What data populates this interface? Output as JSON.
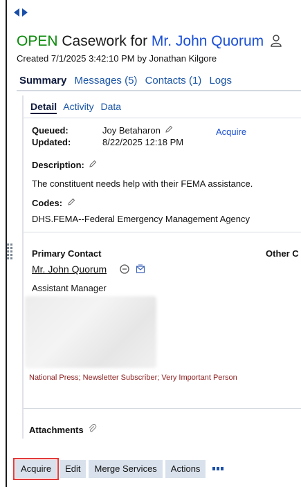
{
  "header": {
    "status": "OPEN",
    "casework_label": "Casework for",
    "person_name": "Mr. John Quorum",
    "created_line": "Created 7/1/2025 3:42:10 PM by Jonathan Kilgore"
  },
  "tabs": [
    {
      "label": "Summary",
      "active": true
    },
    {
      "label": "Messages (5)",
      "active": false
    },
    {
      "label": "Contacts (1)",
      "active": false
    },
    {
      "label": "Logs",
      "active": false
    }
  ],
  "subtabs": [
    {
      "label": "Detail",
      "active": true
    },
    {
      "label": "Activity",
      "active": false
    },
    {
      "label": "Data",
      "active": false
    }
  ],
  "detail": {
    "queued_label": "Queued:",
    "queued_value": "Joy Betaharon",
    "acquire_link": "Acquire",
    "updated_label": "Updated:",
    "updated_value": "8/22/2025 12:18 PM",
    "description_label": "Description:",
    "description_value": "The constituent needs help with their FEMA assistance.",
    "codes_label": "Codes:",
    "codes_value": "DHS.FEMA--Federal Emergency Management Agency"
  },
  "contacts": {
    "primary_label": "Primary Contact",
    "other_label": "Other C",
    "primary_name": "Mr. John Quorum",
    "primary_title": "Assistant Manager",
    "tags_text": "National Press; Newsletter Subscriber; Very Important Person"
  },
  "attachments": {
    "label": "Attachments"
  },
  "toolbar": {
    "acquire": "Acquire",
    "edit": "Edit",
    "merge_services": "Merge Services",
    "actions": "Actions"
  },
  "colors": {
    "status_green": "#0a8a0a",
    "link_blue": "#1a4fd6",
    "tag_red": "#8b1c1c",
    "button_bg": "#d9e2ec",
    "highlight_red": "#e23b3b"
  },
  "icons": [
    "collapse-arrows-icon",
    "person-icon",
    "pencil-icon",
    "remove-circle-icon",
    "email-icon",
    "paperclip-icon",
    "grip-icon",
    "more-icon"
  ]
}
